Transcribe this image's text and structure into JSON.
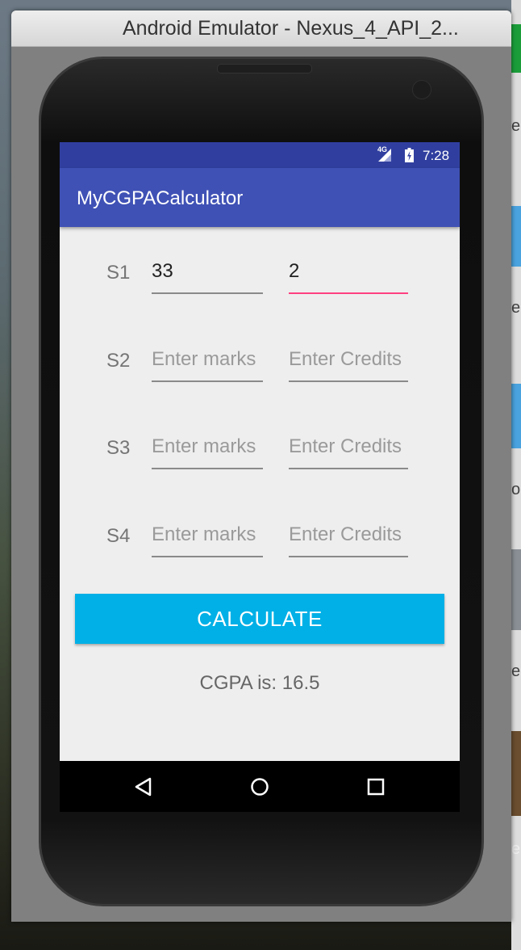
{
  "window": {
    "title": "Android Emulator - Nexus_4_API_2..."
  },
  "statusbar": {
    "network": "4G",
    "time": "7:28"
  },
  "app": {
    "title": "MyCGPACalculator"
  },
  "subjects": [
    {
      "label": "S1",
      "marks_value": "33",
      "marks_placeholder": "Enter marks",
      "credits_value": "2",
      "credits_placeholder": "Enter Credits"
    },
    {
      "label": "S2",
      "marks_value": "",
      "marks_placeholder": "Enter marks",
      "credits_value": "",
      "credits_placeholder": "Enter Credits"
    },
    {
      "label": "S3",
      "marks_value": "",
      "marks_placeholder": "Enter marks",
      "credits_value": "",
      "credits_placeholder": "Enter Credits"
    },
    {
      "label": "S4",
      "marks_value": "",
      "marks_placeholder": "Enter marks",
      "credits_value": "",
      "credits_placeholder": "Enter Credits"
    }
  ],
  "calculate": {
    "label": "CALCULATE"
  },
  "result": {
    "text": "CGPA is: 16.5"
  },
  "navbar": {
    "back_icon": "back-triangle-icon",
    "home_icon": "home-circle-icon",
    "recents_icon": "recents-square-icon"
  },
  "colors": {
    "statusbar": "#303f9f",
    "appbar": "#3f51b5",
    "accent": "#ff4081",
    "button": "#00b0e6"
  }
}
